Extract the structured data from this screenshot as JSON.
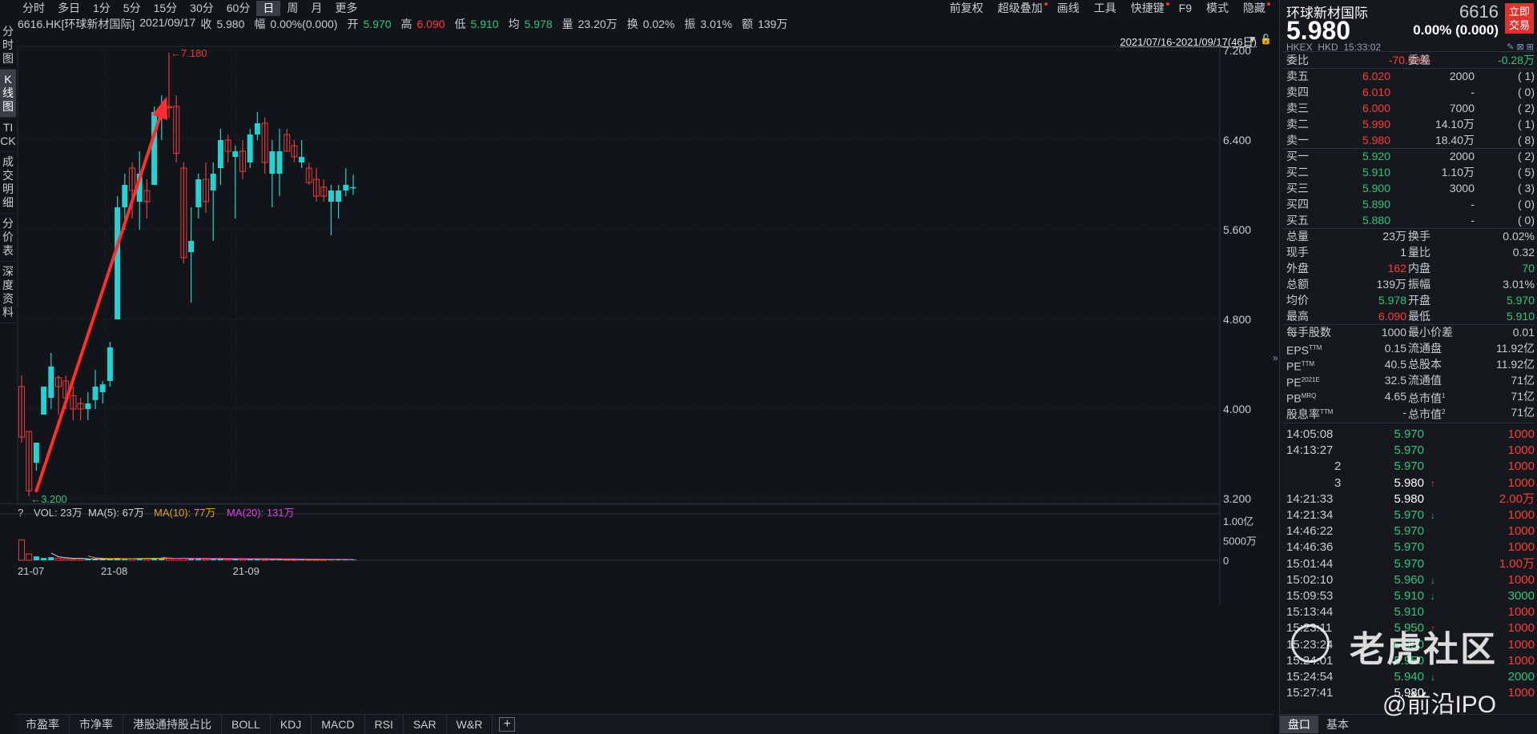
{
  "toolbar": {
    "periods": [
      "分时",
      "多日",
      "1分",
      "5分",
      "15分",
      "30分",
      "60分",
      "日",
      "周",
      "月",
      "更多"
    ],
    "active_period": "日",
    "right_menu": [
      "前复权",
      "超级叠加",
      "画线",
      "工具",
      "快捷键",
      "F9",
      "模式",
      "隐藏"
    ]
  },
  "info": {
    "symbol": "6616.HK[环球新材国际]",
    "date": "2021/09/17",
    "close_label": "收",
    "close": "5.980",
    "change_label": "幅",
    "change": "0.00%(0.000)",
    "open_label": "开",
    "open": "5.970",
    "high_label": "高",
    "high": "6.090",
    "low_label": "低",
    "low": "5.910",
    "avg_label": "均",
    "avg": "5.978",
    "vol_label": "量",
    "vol": "23.20万",
    "turnover_label": "换",
    "turnover": "0.02%",
    "amp_label": "振",
    "amp": "3.01%",
    "amount_label": "额",
    "amount": "139万"
  },
  "left_tabs": [
    "分时图",
    "K线图",
    "TICK",
    "成交明细",
    "分价表",
    "深度资料"
  ],
  "active_left_tab": "K线图",
  "range": "2021/07/16-2021/09/17(46日)",
  "volume_info": {
    "prefix": "?",
    "vol": "VOL: 23万",
    "ma5": "MA(5): 67万",
    "ma10": "MA(10): 77万",
    "ma20": "MA(20): 131万"
  },
  "indicator_tabs": [
    "市盈率",
    "市净率",
    "港股通持股占比",
    "BOLL",
    "KDJ",
    "MACD",
    "RSI",
    "SAR",
    "W&R"
  ],
  "chart_data": {
    "type": "candlestick",
    "y_ticks": [
      "7.200",
      "6.400",
      "5.600",
      "4.800",
      "4.000",
      "3.200"
    ],
    "ylim": [
      3.2,
      7.2
    ],
    "x_ticks": [
      "21-07",
      "21-08",
      "21-09"
    ],
    "annotations": {
      "high": "7.180",
      "low": "3.200"
    },
    "volume_ticks": [
      "1.00亿",
      "5000万",
      "0"
    ],
    "candles": [
      {
        "o": 3.75,
        "h": 4.3,
        "l": 3.7,
        "c": 4.2,
        "up": false
      },
      {
        "o": 3.8,
        "h": 3.8,
        "l": 3.22,
        "c": 3.27,
        "up": false
      },
      {
        "o": 3.52,
        "h": 3.7,
        "l": 3.45,
        "c": 3.7,
        "up": true
      },
      {
        "o": 3.95,
        "h": 4.2,
        "l": 3.95,
        "c": 4.2,
        "up": true
      },
      {
        "o": 4.1,
        "h": 4.5,
        "l": 4.0,
        "c": 4.38,
        "up": true
      },
      {
        "o": 4.2,
        "h": 4.3,
        "l": 3.95,
        "c": 4.28,
        "up": false
      },
      {
        "o": 4.25,
        "h": 4.3,
        "l": 4.0,
        "c": 4.1,
        "up": false
      },
      {
        "o": 4.12,
        "h": 4.2,
        "l": 3.9,
        "c": 4.0,
        "up": false
      },
      {
        "o": 4.05,
        "h": 4.1,
        "l": 3.9,
        "c": 4.0,
        "up": false
      },
      {
        "o": 4.0,
        "h": 4.15,
        "l": 3.9,
        "c": 4.05,
        "up": true
      },
      {
        "o": 4.08,
        "h": 4.35,
        "l": 4.0,
        "c": 4.2,
        "up": true
      },
      {
        "o": 4.15,
        "h": 4.25,
        "l": 4.05,
        "c": 4.22,
        "up": true
      },
      {
        "o": 4.25,
        "h": 4.6,
        "l": 4.2,
        "c": 4.55,
        "up": true
      },
      {
        "o": 4.8,
        "h": 5.9,
        "l": 4.8,
        "c": 5.8,
        "up": true
      },
      {
        "o": 5.8,
        "h": 6.1,
        "l": 5.6,
        "c": 6.0,
        "up": true
      },
      {
        "o": 5.95,
        "h": 6.2,
        "l": 5.7,
        "c": 6.15,
        "up": false
      },
      {
        "o": 5.85,
        "h": 6.3,
        "l": 5.6,
        "c": 6.1,
        "up": true
      },
      {
        "o": 5.85,
        "h": 6.05,
        "l": 5.7,
        "c": 5.95,
        "up": false
      },
      {
        "o": 6.0,
        "h": 6.7,
        "l": 6.0,
        "c": 6.65,
        "up": true
      },
      {
        "o": 6.6,
        "h": 6.8,
        "l": 6.4,
        "c": 6.7,
        "up": true
      },
      {
        "o": 6.7,
        "h": 7.18,
        "l": 6.6,
        "c": 6.7,
        "up": false
      },
      {
        "o": 6.7,
        "h": 6.8,
        "l": 6.2,
        "c": 6.28,
        "up": false
      },
      {
        "o": 6.15,
        "h": 6.2,
        "l": 5.3,
        "c": 5.35,
        "up": false
      },
      {
        "o": 5.4,
        "h": 5.8,
        "l": 4.95,
        "c": 5.5,
        "up": true
      },
      {
        "o": 5.8,
        "h": 6.1,
        "l": 5.7,
        "c": 6.05,
        "up": true
      },
      {
        "o": 6.05,
        "h": 6.2,
        "l": 5.75,
        "c": 5.85,
        "up": false
      },
      {
        "o": 5.95,
        "h": 6.2,
        "l": 5.5,
        "c": 6.1,
        "up": true
      },
      {
        "o": 6.15,
        "h": 6.5,
        "l": 6.0,
        "c": 6.4,
        "up": true
      },
      {
        "o": 6.4,
        "h": 6.45,
        "l": 6.2,
        "c": 6.3,
        "up": false
      },
      {
        "o": 6.25,
        "h": 6.35,
        "l": 5.7,
        "c": 6.3,
        "up": true
      },
      {
        "o": 6.3,
        "h": 6.4,
        "l": 6.05,
        "c": 6.12,
        "up": false
      },
      {
        "o": 6.2,
        "h": 6.5,
        "l": 6.15,
        "c": 6.45,
        "up": true
      },
      {
        "o": 6.45,
        "h": 6.65,
        "l": 6.4,
        "c": 6.55,
        "up": true
      },
      {
        "o": 6.55,
        "h": 6.6,
        "l": 6.1,
        "c": 6.2,
        "up": false
      },
      {
        "o": 6.3,
        "h": 6.4,
        "l": 5.8,
        "c": 6.1,
        "up": true
      },
      {
        "o": 6.1,
        "h": 6.5,
        "l": 5.9,
        "c": 6.3,
        "up": true
      },
      {
        "o": 6.45,
        "h": 6.5,
        "l": 6.3,
        "c": 6.3,
        "up": false
      },
      {
        "o": 6.35,
        "h": 6.4,
        "l": 6.2,
        "c": 6.25,
        "up": false
      },
      {
        "o": 6.25,
        "h": 6.4,
        "l": 6.15,
        "c": 6.2,
        "up": true
      },
      {
        "o": 6.15,
        "h": 6.2,
        "l": 6.0,
        "c": 6.02,
        "up": false
      },
      {
        "o": 6.05,
        "h": 6.15,
        "l": 5.85,
        "c": 5.9,
        "up": false
      },
      {
        "o": 5.9,
        "h": 6.05,
        "l": 5.85,
        "c": 5.98,
        "up": false
      },
      {
        "o": 5.95,
        "h": 6.0,
        "l": 5.55,
        "c": 5.85,
        "up": true
      },
      {
        "o": 5.85,
        "h": 6.0,
        "l": 5.7,
        "c": 5.95,
        "up": true
      },
      {
        "o": 5.95,
        "h": 6.15,
        "l": 5.9,
        "c": 6.0,
        "up": true
      },
      {
        "o": 5.97,
        "h": 6.09,
        "l": 5.91,
        "c": 5.98,
        "up": true
      }
    ],
    "volumes": [
      0.52,
      0.16,
      0.1,
      0.06,
      0.08,
      0.05,
      0.04,
      0.03,
      0.04,
      0.03,
      0.04,
      0.03,
      0.03,
      0.06,
      0.05,
      0.04,
      0.05,
      0.04,
      0.06,
      0.05,
      0.06,
      0.05,
      0.05,
      0.04,
      0.04,
      0.03,
      0.03,
      0.04,
      0.03,
      0.03,
      0.03,
      0.03,
      0.03,
      0.02,
      0.02,
      0.02,
      0.02,
      0.02,
      0.02,
      0.02,
      0.02,
      0.02,
      0.02,
      0.02,
      0.02,
      0.02
    ]
  },
  "panel": {
    "name": "环球新材国际",
    "code": "6616",
    "trade_button": [
      "立即",
      "交易"
    ],
    "price": "5.980",
    "change": "0.00% (0.000)",
    "exchange": "HKEX",
    "currency": "HKD",
    "time": "15:33:02",
    "weibi": {
      "label": "委比",
      "value": "-70.50%",
      "label2": "委差",
      "value2": "-0.28万"
    },
    "asks": [
      {
        "label": "卖五",
        "price": "6.020",
        "vol": "2000",
        "cnt": "( 1)"
      },
      {
        "label": "卖四",
        "price": "6.010",
        "vol": "-",
        "cnt": "( 0)"
      },
      {
        "label": "卖三",
        "price": "6.000",
        "vol": "7000",
        "cnt": "( 2)"
      },
      {
        "label": "卖二",
        "price": "5.990",
        "vol": "14.10万",
        "cnt": "( 1)"
      },
      {
        "label": "卖一",
        "price": "5.980",
        "vol": "18.40万",
        "cnt": "( 8)"
      }
    ],
    "bids": [
      {
        "label": "买一",
        "price": "5.920",
        "vol": "2000",
        "cnt": "( 2)"
      },
      {
        "label": "买二",
        "price": "5.910",
        "vol": "1.10万",
        "cnt": "( 5)"
      },
      {
        "label": "买三",
        "price": "5.900",
        "vol": "3000",
        "cnt": "( 3)"
      },
      {
        "label": "买四",
        "price": "5.890",
        "vol": "-",
        "cnt": "( 0)"
      },
      {
        "label": "买五",
        "price": "5.880",
        "vol": "-",
        "cnt": "( 0)"
      }
    ],
    "stats": [
      {
        "l1": "总量",
        "v1": "23万",
        "l2": "换手",
        "v2": "0.02%",
        "c1": "grey",
        "c2": "grey"
      },
      {
        "l1": "现手",
        "v1": "1",
        "l2": "量比",
        "v2": "0.32",
        "c1": "grey",
        "c2": "grey"
      },
      {
        "l1": "外盘",
        "v1": "162",
        "l2": "内盘",
        "v2": "70",
        "c1": "red",
        "c2": "green"
      },
      {
        "l1": "总额",
        "v1": "139万",
        "l2": "振幅",
        "v2": "3.01%",
        "c1": "grey",
        "c2": "grey"
      },
      {
        "l1": "均价",
        "v1": "5.978",
        "l2": "开盘",
        "v2": "5.970",
        "c1": "green",
        "c2": "green"
      },
      {
        "l1": "最高",
        "v1": "6.090",
        "l2": "最低",
        "v2": "5.910",
        "c1": "red",
        "c2": "green"
      }
    ],
    "fundamentals": [
      {
        "l1": "每手股数",
        "v1": "1000",
        "l2": "最小价差",
        "v2": "0.01"
      },
      {
        "l1": "EPS",
        "sup1": "TTM",
        "v1": "0.15",
        "l2": "流通盘",
        "v2": "11.92亿"
      },
      {
        "l1": "PE",
        "sup1": "TTM",
        "v1": "40.5",
        "l2": "总股本",
        "v2": "11.92亿"
      },
      {
        "l1": "PE",
        "sup1": "2021E",
        "v1": "32.5",
        "l2": "流通值",
        "v2": "71亿"
      },
      {
        "l1": "PB",
        "sup1": "MRQ",
        "v1": "4.65",
        "l2": "总市值",
        "sup2": "1",
        "v2": "71亿"
      },
      {
        "l1": "股息率",
        "sup1": "TTM",
        "v1": "-",
        "l2": "总市值",
        "sup2": "2",
        "v2": "71亿"
      }
    ],
    "ticks": [
      {
        "t": "14:05:08",
        "p": "5.970",
        "pc": "green",
        "a": "",
        "v": "1000",
        "vc": "red"
      },
      {
        "t": "14:13:27",
        "p": "5.970",
        "pc": "green",
        "a": "",
        "v": "1000",
        "vc": "red"
      },
      {
        "t": "2",
        "p": "5.970",
        "pc": "green",
        "a": "",
        "v": "1000",
        "vc": "red"
      },
      {
        "t": "3",
        "p": "5.980",
        "pc": "white",
        "a": "↑",
        "ac": "red",
        "v": "1000",
        "vc": "red"
      },
      {
        "t": "14:21:33",
        "p": "5.980",
        "pc": "white",
        "a": "",
        "v": "2.00万",
        "vc": "red"
      },
      {
        "t": "14:21:34",
        "p": "5.970",
        "pc": "green",
        "a": "↓",
        "ac": "green",
        "v": "1000",
        "vc": "red"
      },
      {
        "t": "14:46:22",
        "p": "5.970",
        "pc": "green",
        "a": "",
        "v": "1000",
        "vc": "red"
      },
      {
        "t": "14:46:36",
        "p": "5.970",
        "pc": "green",
        "a": "",
        "v": "1000",
        "vc": "red"
      },
      {
        "t": "15:01:44",
        "p": "5.970",
        "pc": "green",
        "a": "",
        "v": "1.00万",
        "vc": "red"
      },
      {
        "t": "15:02:10",
        "p": "5.960",
        "pc": "green",
        "a": "↓",
        "ac": "green",
        "v": "1000",
        "vc": "red"
      },
      {
        "t": "15:09:53",
        "p": "5.910",
        "pc": "green",
        "a": "↓",
        "ac": "green",
        "v": "3000",
        "vc": "green"
      },
      {
        "t": "15:13:44",
        "p": "5.910",
        "pc": "green",
        "a": "",
        "v": "1000",
        "vc": "red"
      },
      {
        "t": "15:23:11",
        "p": "5.950",
        "pc": "green",
        "a": "↑",
        "ac": "red",
        "v": "1000",
        "vc": "red"
      },
      {
        "t": "15:23:24",
        "p": "5.950",
        "pc": "green",
        "a": "",
        "v": "1000",
        "vc": "red"
      },
      {
        "t": "15:24:01",
        "p": "5.950",
        "pc": "green",
        "a": "",
        "v": "1000",
        "vc": "red"
      },
      {
        "t": "15:24:54",
        "p": "5.940",
        "pc": "green",
        "a": "↓",
        "ac": "green",
        "v": "2000",
        "vc": "green"
      },
      {
        "t": "15:27:41",
        "p": "5.980",
        "pc": "white",
        "a": "",
        "v": "1000",
        "vc": "red"
      }
    ],
    "bottom_tabs": [
      "盘口",
      "基本"
    ],
    "active_bottom_tab": "盘口"
  },
  "watermark": {
    "brand": "老虎社区",
    "handle": "@前沿IPO"
  },
  "colors": {
    "up": "#25d1d1",
    "down": "#e53c3c",
    "ma5": "#d4d4d4",
    "ma10": "#e8a317",
    "ma20": "#e042e0",
    "arrow": "#ff2d2d",
    "bg": "#111418"
  }
}
